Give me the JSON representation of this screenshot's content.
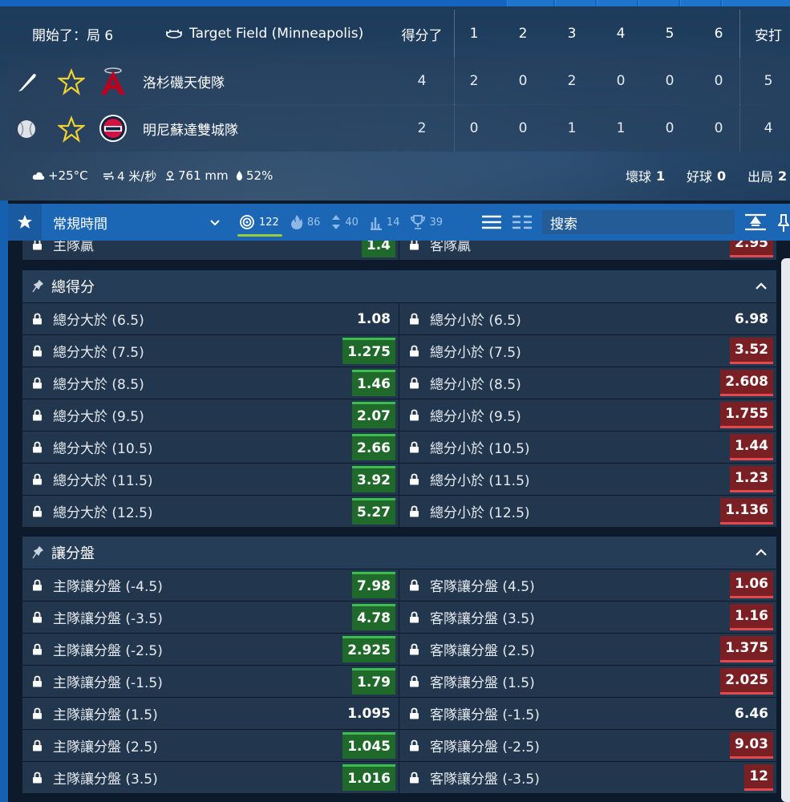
{
  "scoreboard": {
    "status": "開始了：局 6",
    "venue": "Target Field (Minneapolis)",
    "columns": [
      "得分了",
      "1",
      "2",
      "3",
      "4",
      "5",
      "6",
      "安打"
    ],
    "teams": [
      {
        "name": "洛杉磯天使隊",
        "scores": [
          "4",
          "2",
          "0",
          "2",
          "0",
          "0",
          "0",
          "5"
        ],
        "logo": "angels-logo",
        "batting": true
      },
      {
        "name": "明尼蘇達雙城隊",
        "scores": [
          "2",
          "0",
          "0",
          "1",
          "1",
          "0",
          "0",
          "4"
        ],
        "logo": "twins-logo",
        "batting": false
      }
    ],
    "weather": {
      "temp": "+25°C",
      "wind": "4 米/秒",
      "pressure": "761 mm",
      "humidity": "52%"
    },
    "count": {
      "balls_label": "壞球",
      "balls": "1",
      "strikes_label": "好球",
      "strikes": "0",
      "outs_label": "出局",
      "outs": "2"
    }
  },
  "toolbar": {
    "period": "常規時間",
    "filters": [
      {
        "icon": "target-icon",
        "count": "122",
        "active": true
      },
      {
        "icon": "fire-icon",
        "count": "86",
        "active": false
      },
      {
        "icon": "updown-icon",
        "count": "40",
        "active": false
      },
      {
        "icon": "bars-icon",
        "count": "14",
        "active": false
      },
      {
        "icon": "trophy-icon",
        "count": "39",
        "active": false
      }
    ],
    "search_placeholder": "搜索"
  },
  "colors": {
    "up": "#1f6a2a",
    "down": "#7a1f24",
    "accent": "#1b66b5",
    "active_underline": "#9ccc3c"
  },
  "markets": {
    "partial_row": {
      "left_label": "主隊贏",
      "left_odd": "1.4",
      "left_trend": "up",
      "right_label": "客隊贏",
      "right_odd": "2.95",
      "right_trend": "down"
    },
    "sections": [
      {
        "title": "總得分",
        "rows": [
          {
            "left_label": "總分大於 (6.5)",
            "left_odd": "1.08",
            "left_trend": "flat",
            "right_label": "總分小於 (6.5)",
            "right_odd": "6.98",
            "right_trend": "flat"
          },
          {
            "left_label": "總分大於 (7.5)",
            "left_odd": "1.275",
            "left_trend": "up",
            "right_label": "總分小於 (7.5)",
            "right_odd": "3.52",
            "right_trend": "down"
          },
          {
            "left_label": "總分大於 (8.5)",
            "left_odd": "1.46",
            "left_trend": "up",
            "right_label": "總分小於 (8.5)",
            "right_odd": "2.608",
            "right_trend": "down"
          },
          {
            "left_label": "總分大於 (9.5)",
            "left_odd": "2.07",
            "left_trend": "up",
            "right_label": "總分小於 (9.5)",
            "right_odd": "1.755",
            "right_trend": "down"
          },
          {
            "left_label": "總分大於 (10.5)",
            "left_odd": "2.66",
            "left_trend": "up",
            "right_label": "總分小於 (10.5)",
            "right_odd": "1.44",
            "right_trend": "down"
          },
          {
            "left_label": "總分大於 (11.5)",
            "left_odd": "3.92",
            "left_trend": "up",
            "right_label": "總分小於 (11.5)",
            "right_odd": "1.23",
            "right_trend": "down"
          },
          {
            "left_label": "總分大於 (12.5)",
            "left_odd": "5.27",
            "left_trend": "up",
            "right_label": "總分小於 (12.5)",
            "right_odd": "1.136",
            "right_trend": "down"
          }
        ]
      },
      {
        "title": "讓分盤",
        "rows": [
          {
            "left_label": "主隊讓分盤 (-4.5)",
            "left_odd": "7.98",
            "left_trend": "up",
            "right_label": "客隊讓分盤 (4.5)",
            "right_odd": "1.06",
            "right_trend": "down"
          },
          {
            "left_label": "主隊讓分盤 (-3.5)",
            "left_odd": "4.78",
            "left_trend": "up",
            "right_label": "客隊讓分盤 (3.5)",
            "right_odd": "1.16",
            "right_trend": "down"
          },
          {
            "left_label": "主隊讓分盤 (-2.5)",
            "left_odd": "2.925",
            "left_trend": "up",
            "right_label": "客隊讓分盤 (2.5)",
            "right_odd": "1.375",
            "right_trend": "down"
          },
          {
            "left_label": "主隊讓分盤 (-1.5)",
            "left_odd": "1.79",
            "left_trend": "up",
            "right_label": "客隊讓分盤 (1.5)",
            "right_odd": "2.025",
            "right_trend": "down"
          },
          {
            "left_label": "主隊讓分盤 (1.5)",
            "left_odd": "1.095",
            "left_trend": "flat",
            "right_label": "客隊讓分盤 (-1.5)",
            "right_odd": "6.46",
            "right_trend": "flat"
          },
          {
            "left_label": "主隊讓分盤 (2.5)",
            "left_odd": "1.045",
            "left_trend": "up",
            "right_label": "客隊讓分盤 (-2.5)",
            "right_odd": "9.03",
            "right_trend": "down"
          },
          {
            "left_label": "主隊讓分盤 (3.5)",
            "left_odd": "1.016",
            "left_trend": "up",
            "right_label": "客隊讓分盤 (-3.5)",
            "right_odd": "12",
            "right_trend": "down"
          }
        ]
      }
    ]
  }
}
